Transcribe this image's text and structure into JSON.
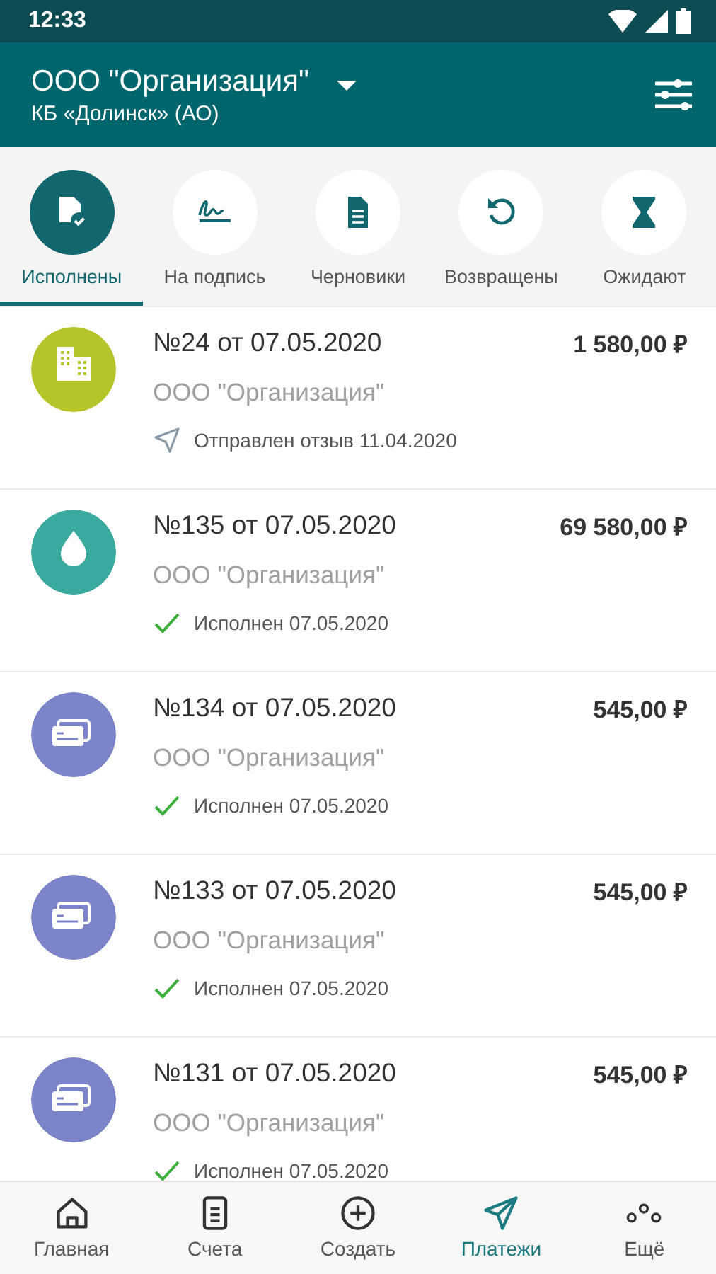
{
  "status_bar": {
    "time": "12:33"
  },
  "app_bar": {
    "title": "ООО \"Организация\"",
    "subtitle": "КБ «Долинск» (АО)"
  },
  "tabs": [
    {
      "label": "Исполнены",
      "selected": true
    },
    {
      "label": "На подпись",
      "selected": false
    },
    {
      "label": "Черновики",
      "selected": false
    },
    {
      "label": "Возвращены",
      "selected": false
    },
    {
      "label": "Ожидают",
      "selected": false
    }
  ],
  "payments": [
    {
      "kind": "building",
      "color": "#b6c42c",
      "title": "№24 от 07.05.2020",
      "amount": "1 580,00 ₽",
      "payee": "ООО \"Организация\"",
      "status": {
        "kind": "sent",
        "text": "Отправлен отзыв 11.04.2020"
      }
    },
    {
      "kind": "drop",
      "color": "#3aaa9f",
      "title": "№135 от 07.05.2020",
      "amount": "69 580,00 ₽",
      "payee": "ООО \"Организация\"",
      "status": {
        "kind": "done",
        "text": "Исполнен 07.05.2020"
      }
    },
    {
      "kind": "card",
      "color": "#7b84c9",
      "title": "№134 от 07.05.2020",
      "amount": "545,00 ₽",
      "payee": "ООО \"Организация\"",
      "status": {
        "kind": "done",
        "text": "Исполнен 07.05.2020"
      }
    },
    {
      "kind": "card",
      "color": "#7b84c9",
      "title": "№133 от 07.05.2020",
      "amount": "545,00 ₽",
      "payee": "ООО \"Организация\"",
      "status": {
        "kind": "done",
        "text": "Исполнен 07.05.2020"
      }
    },
    {
      "kind": "card",
      "color": "#7b84c9",
      "title": "№131 от 07.05.2020",
      "amount": "545,00 ₽",
      "payee": "ООО \"Организация\"",
      "status": {
        "kind": "done",
        "text": "Исполнен 07.05.2020"
      }
    }
  ],
  "bottom_nav": [
    {
      "label": "Главная",
      "selected": false
    },
    {
      "label": "Счета",
      "selected": false
    },
    {
      "label": "Создать",
      "selected": false
    },
    {
      "label": "Платежи",
      "selected": true
    },
    {
      "label": "Ещё",
      "selected": false
    }
  ]
}
